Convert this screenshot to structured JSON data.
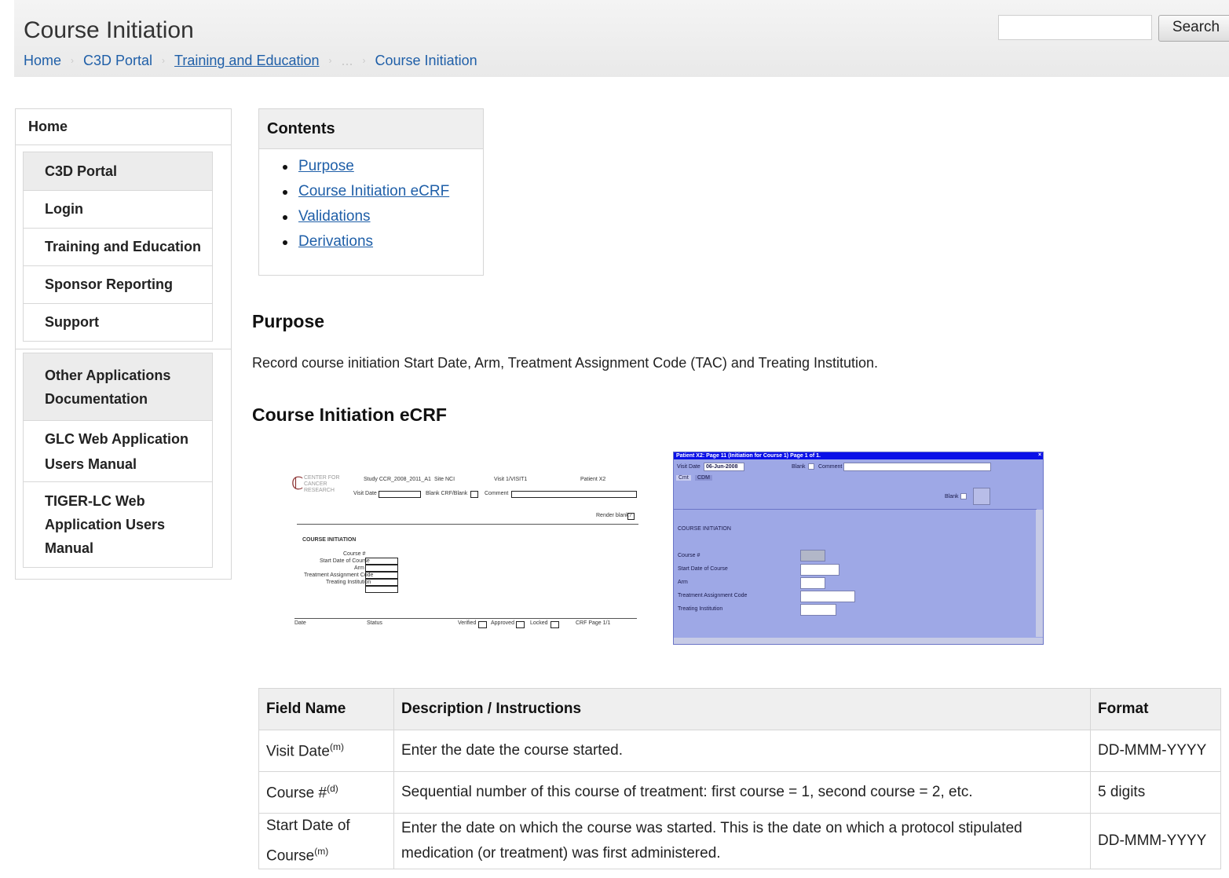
{
  "header": {
    "title": "Course Initiation",
    "breadcrumb": [
      "Home",
      "C3D Portal",
      "Training and Education",
      "...",
      "Course Initiation"
    ],
    "search_placeholder": "",
    "search_button": "Search"
  },
  "sidebar": {
    "home": "Home",
    "group1": [
      "C3D Portal",
      "Login",
      "Training and Education",
      "Sponsor Reporting",
      "Support"
    ],
    "group2": [
      {
        "line1": "Other Applications",
        "line2": "Documentation"
      },
      {
        "line1": "GLC Web Application",
        "line2": "Users Manual"
      },
      {
        "line1": "TIGER-LC Web",
        "line2": "Application Users",
        "line3": "Manual"
      }
    ]
  },
  "contents": {
    "heading": "Contents",
    "items": [
      "Purpose",
      "Course Initiation eCRF",
      "Validations",
      "Derivations"
    ]
  },
  "purpose": {
    "heading": "Purpose",
    "text": "Record course initiation Start Date, Arm, Treatment Assignment Code (TAC) and Treating Institution."
  },
  "ecrf": {
    "heading": "Course Initiation eCRF",
    "paper_form": {
      "org_line1": "CENTER FOR",
      "org_line2": "CANCER",
      "org_line3": "RESEARCH",
      "study": "Study CCR_2008_2011_A1",
      "site": "Site NCI",
      "visit": "Visit 1/VISIT1",
      "patient": "Patient X2",
      "visit_date": "Visit Date",
      "blank_crf": "Blank CRF/Blank",
      "comment": "Comment",
      "render_blank": "Render blank?",
      "section": "COURSE INITIATION",
      "fields": [
        "Course #",
        "Start Date of Course",
        "Arm",
        "Treatment Assignment Code",
        "Treating Institution"
      ],
      "footer": [
        "Date",
        "Status",
        "Verified",
        "Approved",
        "Locked",
        "CRF Page 1/1"
      ]
    },
    "screen_form": {
      "title": "Patient X2: Page 11 (Initiation for Course 1) Page 1 of 1.",
      "visit_date_label": "Visit Date",
      "visit_date_value": "06-Jun-2008",
      "blank_label": "Blank",
      "comment_label": "Comment",
      "tabs": [
        "Cmt",
        "CDM"
      ],
      "blank2_label": "Blank",
      "section": "COURSE INITIATION",
      "fields": [
        "Course #",
        "Start Date of Course",
        "Arm",
        "Treatment Assignment Code",
        "Treating Institution"
      ]
    }
  },
  "table": {
    "headers": [
      "Field Name",
      "Description / Instructions",
      "Format"
    ],
    "rows": [
      {
        "name": "Visit Date",
        "sup": "(m)",
        "desc": "Enter the date the course started.",
        "format": "DD-MMM-YYYY"
      },
      {
        "name": "Course #",
        "sup": "(d)",
        "desc": "Sequential number of this course of treatment: first course = 1, second course = 2, etc.",
        "format": "5 digits"
      },
      {
        "name_line1": "Start Date of",
        "name_line2": "Course",
        "sup": "(m)",
        "desc_line1": "Enter the date on which the course was started. This is the date on which a protocol stipulated",
        "desc_line2": "medication (or treatment) was first administered.",
        "format": "DD-MMM-YYYY"
      }
    ]
  }
}
